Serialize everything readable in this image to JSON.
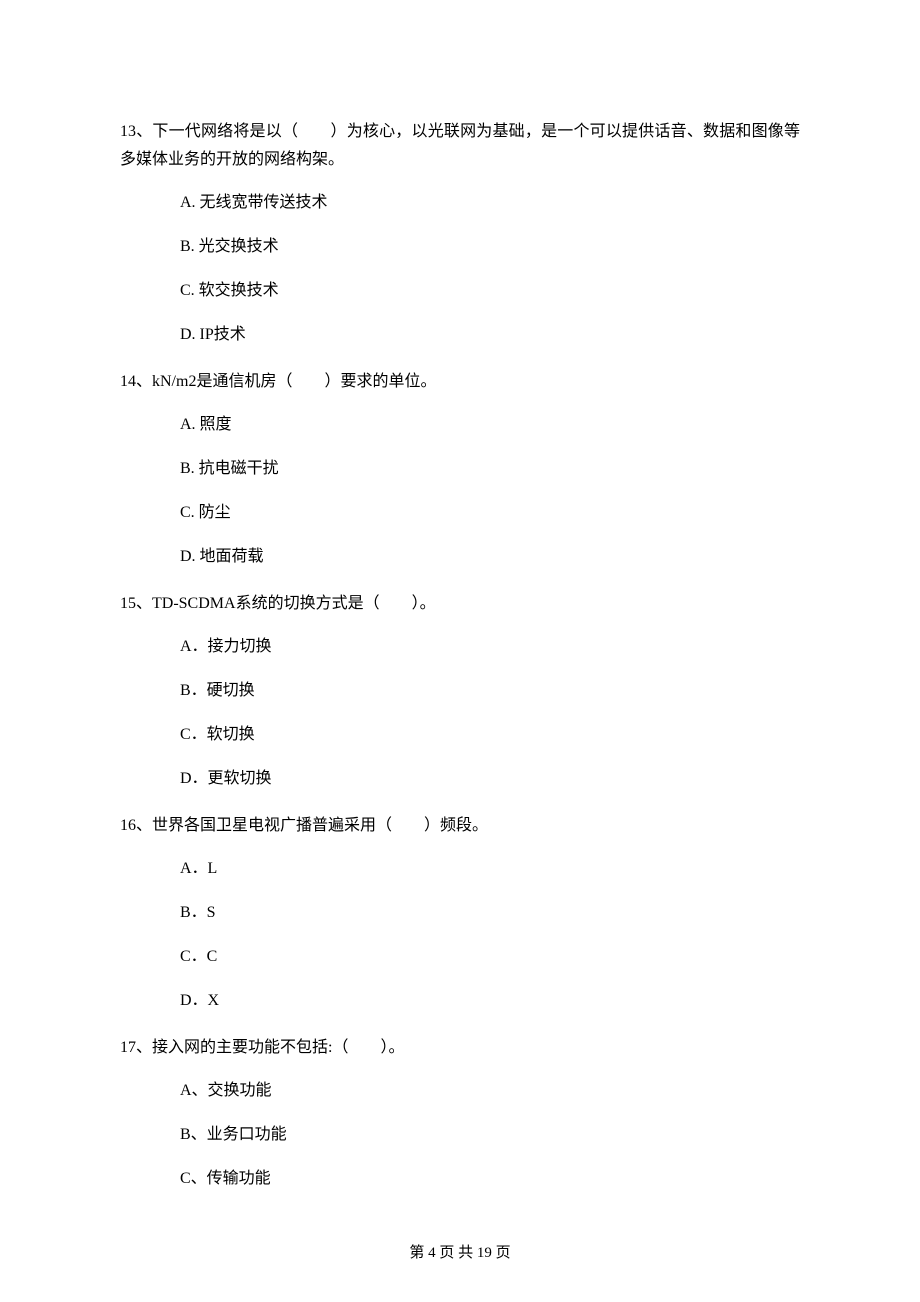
{
  "questions": [
    {
      "number": "13",
      "text": "13、下一代网络将是以（　　）为核心，以光联网为基础，是一个可以提供话音、数据和图像等多媒体业务的开放的网络构架。",
      "options": [
        "A.  无线宽带传送技术",
        "B.  光交换技术",
        "C.  软交换技术",
        "D.  IP技术"
      ]
    },
    {
      "number": "14",
      "text": "14、kN/m2是通信机房（　　）要求的单位。",
      "options": [
        "A.  照度",
        "B.  抗电磁干扰",
        "C.  防尘",
        "D.  地面荷载"
      ]
    },
    {
      "number": "15",
      "text": "15、TD-SCDMA系统的切换方式是（　　）。",
      "options": [
        "A．接力切换",
        "B．硬切换",
        "C．软切换",
        "D．更软切换"
      ]
    },
    {
      "number": "16",
      "text": "16、世界各国卫星电视广播普遍采用（　　）频段。",
      "options": [
        "A．L",
        "B．S",
        "C．C",
        "D．X"
      ]
    },
    {
      "number": "17",
      "text": "17、接入网的主要功能不包括:（　　）。",
      "options": [
        "A、交换功能",
        "B、业务口功能",
        "C、传输功能"
      ]
    }
  ],
  "footer": "第 4 页 共 19 页"
}
